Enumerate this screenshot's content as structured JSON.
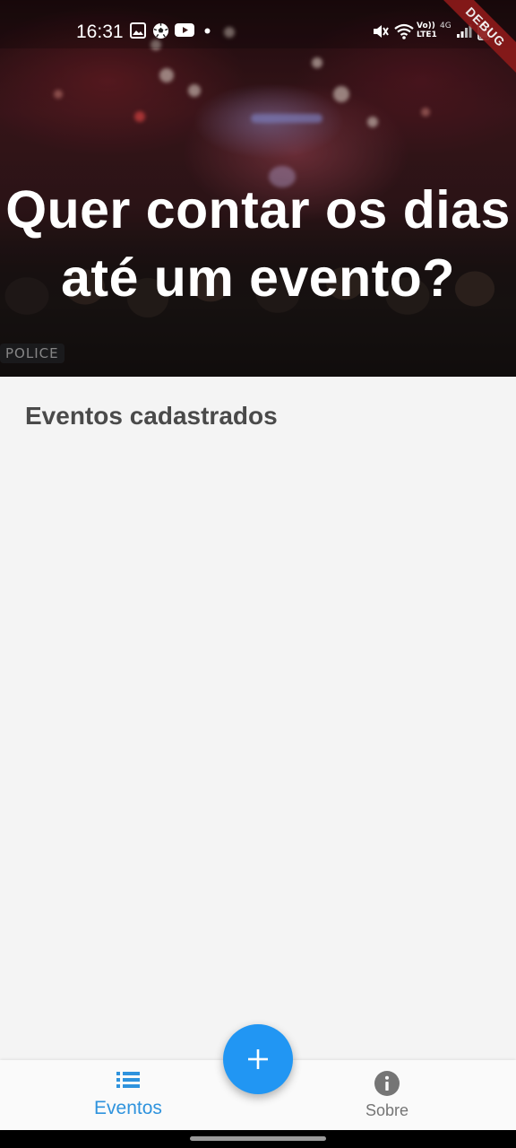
{
  "status_bar": {
    "time": "16:31",
    "left_icons": [
      "image-icon",
      "soccer-ball-icon",
      "youtube-icon",
      "dot-icon"
    ],
    "right_icons": [
      "mute-icon",
      "wifi-icon",
      "volte-icon",
      "signal-icon",
      "battery-icon"
    ],
    "volte_label": "Vo)) LTE1",
    "network_label": "4G",
    "debug_banner": "DEBUG"
  },
  "hero": {
    "title_line1": "Quer contar os dias",
    "title_line2": "até um evento?",
    "background_sign": "POLICE"
  },
  "main": {
    "section_title": "Eventos cadastrados",
    "events": []
  },
  "bottom_nav": {
    "items": [
      {
        "label": "Eventos",
        "icon": "list-icon",
        "active": true
      },
      {
        "label": "Sobre",
        "icon": "info-icon",
        "active": false
      }
    ],
    "fab": {
      "icon": "plus-icon"
    }
  },
  "colors": {
    "accent": "#2196f3",
    "nav_active": "#2f93dd",
    "nav_inactive": "#757575",
    "section_title": "#4a4a4a",
    "background": "#f4f4f4",
    "debug_ribbon": "#8b1a1a"
  }
}
